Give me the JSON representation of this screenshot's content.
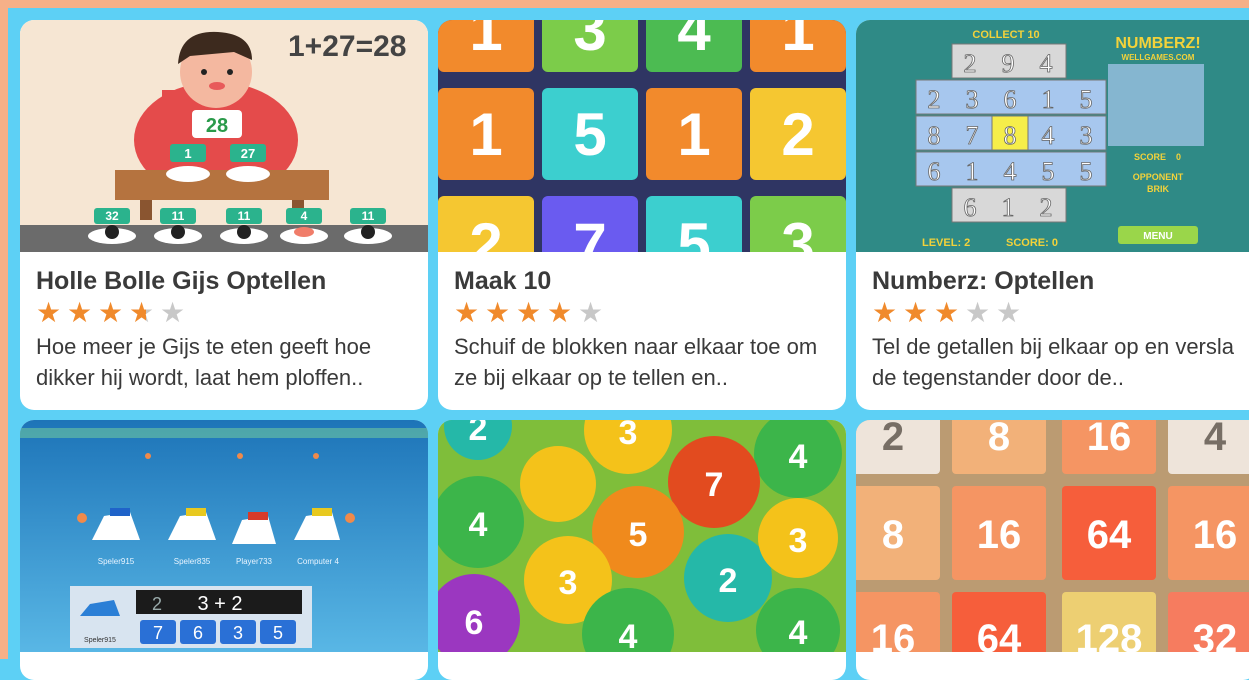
{
  "colors": {
    "page_bg": "#5dd0f5",
    "frame": "#f6b088",
    "star_on": "#f08a2c",
    "star_off": "#c8c8c8"
  },
  "games": [
    {
      "title": "Holle Bolle Gijs Optellen",
      "rating": 3.5,
      "desc": "Hoe meer je Gijs te eten geeft hoe dikker hij wordt, laat hem ploffen..",
      "thumb": {
        "equation": "1+27=28",
        "shirt": "28",
        "plates": [
          "1",
          "27"
        ],
        "sushi": [
          "32",
          "11",
          "11",
          "4",
          "11"
        ]
      }
    },
    {
      "title": "Maak 10",
      "rating": 4,
      "desc": "Schuif de blokken naar elkaar toe om ze bij elkaar op te tellen en..",
      "thumb": {
        "tiles": [
          "1",
          "3",
          "4",
          "1",
          "1",
          "5",
          "1",
          "2",
          "2",
          "7",
          "5",
          "3"
        ]
      }
    },
    {
      "title": "Numberz: Optellen",
      "rating": 3,
      "desc": "Tel de getallen bij elkaar op en versla de tegenstander door de..",
      "thumb": {
        "collect": "COLLECT 10",
        "logo": "NUMBERZ!",
        "site": "WELLGAMES.COM",
        "score_label": "SCORE",
        "score_value": "0",
        "opponent": "OPPONENT",
        "opponent_name": "BRIK",
        "level": "LEVEL: 2",
        "score_bottom": "SCORE: 0",
        "menu": "MENU",
        "grid": [
          "2",
          "9",
          "4",
          "2",
          "3",
          "6",
          "1",
          "5",
          "8",
          "7",
          "8",
          "4",
          "3",
          "6",
          "1",
          "4",
          "5",
          "5",
          "6",
          "1",
          "2"
        ]
      }
    },
    {
      "title": "",
      "rating": 0,
      "desc": "",
      "thumb": {
        "players": [
          "Speler915",
          "Speler835",
          "Player733",
          "Computer 4"
        ],
        "question": "3 + 2",
        "answers": [
          "7",
          "6",
          "3",
          "5"
        ],
        "me": "Speler915",
        "qnum": "2"
      }
    },
    {
      "title": "",
      "rating": 0,
      "desc": "",
      "thumb": {
        "balls": [
          "2",
          "3",
          "4",
          "7",
          "4",
          "5",
          "2",
          "3",
          "3",
          "6",
          "4",
          "4"
        ]
      }
    },
    {
      "title": "",
      "rating": 0,
      "desc": "",
      "thumb": {
        "tiles": [
          "2",
          "8",
          "16",
          "4",
          "8",
          "16",
          "64",
          "16",
          "16",
          "64",
          "128",
          "32"
        ]
      }
    }
  ]
}
